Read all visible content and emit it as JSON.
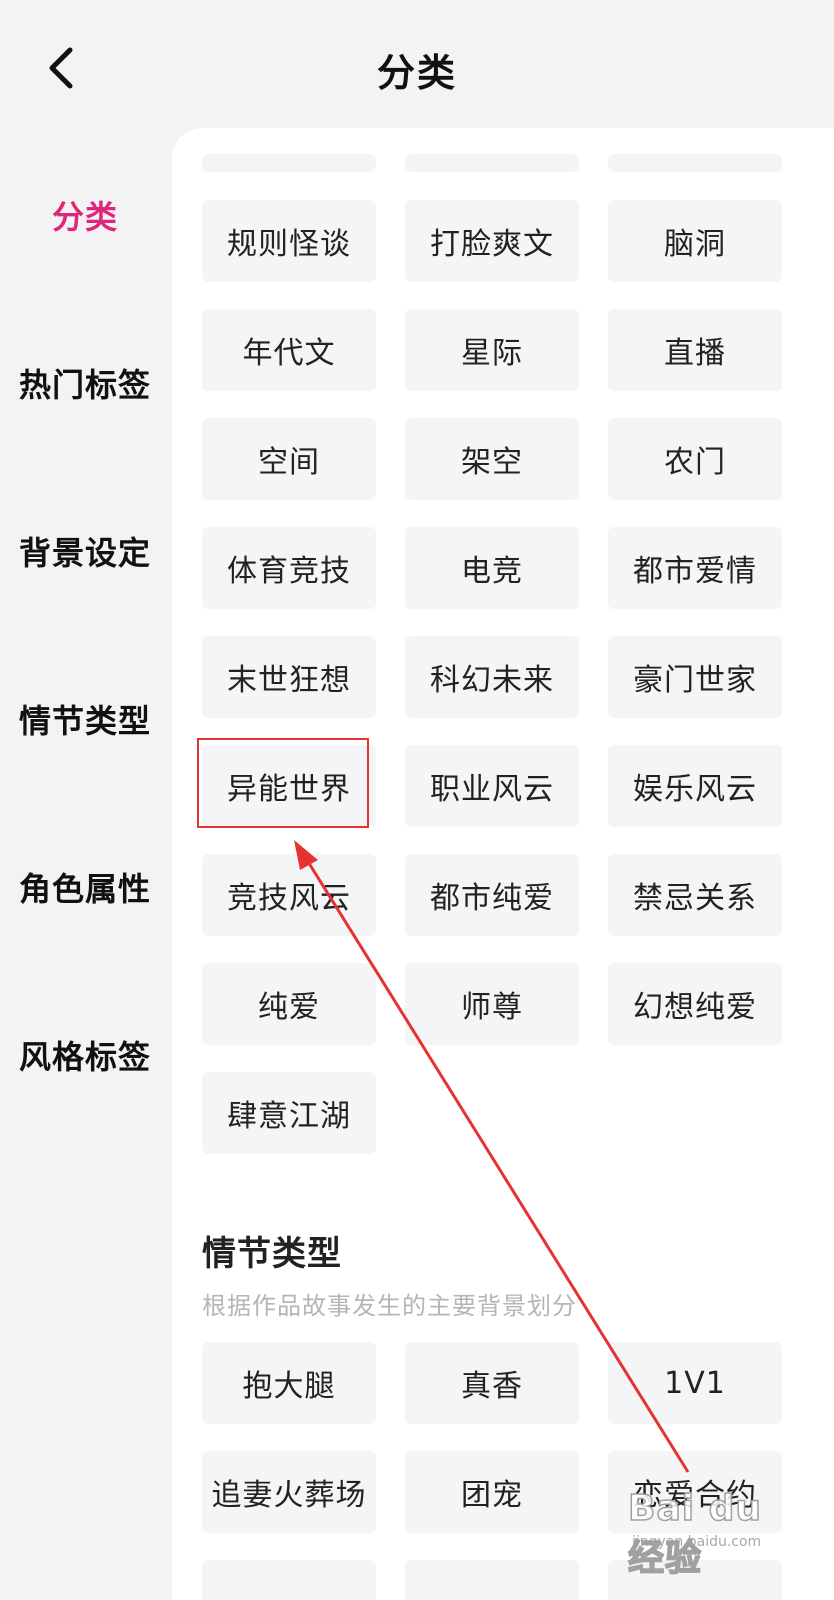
{
  "header": {
    "title": "分类",
    "back_icon": "chevron-left-icon"
  },
  "sidebar": {
    "active_color": "#e0267a",
    "items": [
      {
        "label": "分类",
        "active": true
      },
      {
        "label": "热门标签",
        "active": false
      },
      {
        "label": "背景设定",
        "active": false
      },
      {
        "label": "情节类型",
        "active": false
      },
      {
        "label": "角色属性",
        "active": false
      },
      {
        "label": "风格标签",
        "active": false
      }
    ]
  },
  "category_tags": [
    "规则怪谈",
    "打脸爽文",
    "脑洞",
    "年代文",
    "星际",
    "直播",
    "空间",
    "架空",
    "农门",
    "体育竞技",
    "电竞",
    "都市爱情",
    "末世狂想",
    "科幻未来",
    "豪门世家",
    "异能世界",
    "职业风云",
    "娱乐风云",
    "竞技风云",
    "都市纯爱",
    "禁忌关系",
    "纯爱",
    "师尊",
    "幻想纯爱",
    "肆意江湖"
  ],
  "plot_section": {
    "title": "情节类型",
    "description": "根据作品故事发生的主要背景划分",
    "tags": [
      "抱大腿",
      "真香",
      "1V1",
      "追妻火葬场",
      "团宠",
      "恋爱合约"
    ]
  },
  "annotation": {
    "color": "#e53333",
    "highlighted_tag": "异能世界"
  },
  "watermark": {
    "logo": "Bai du 经验",
    "url": "jingyan.baidu.com"
  }
}
